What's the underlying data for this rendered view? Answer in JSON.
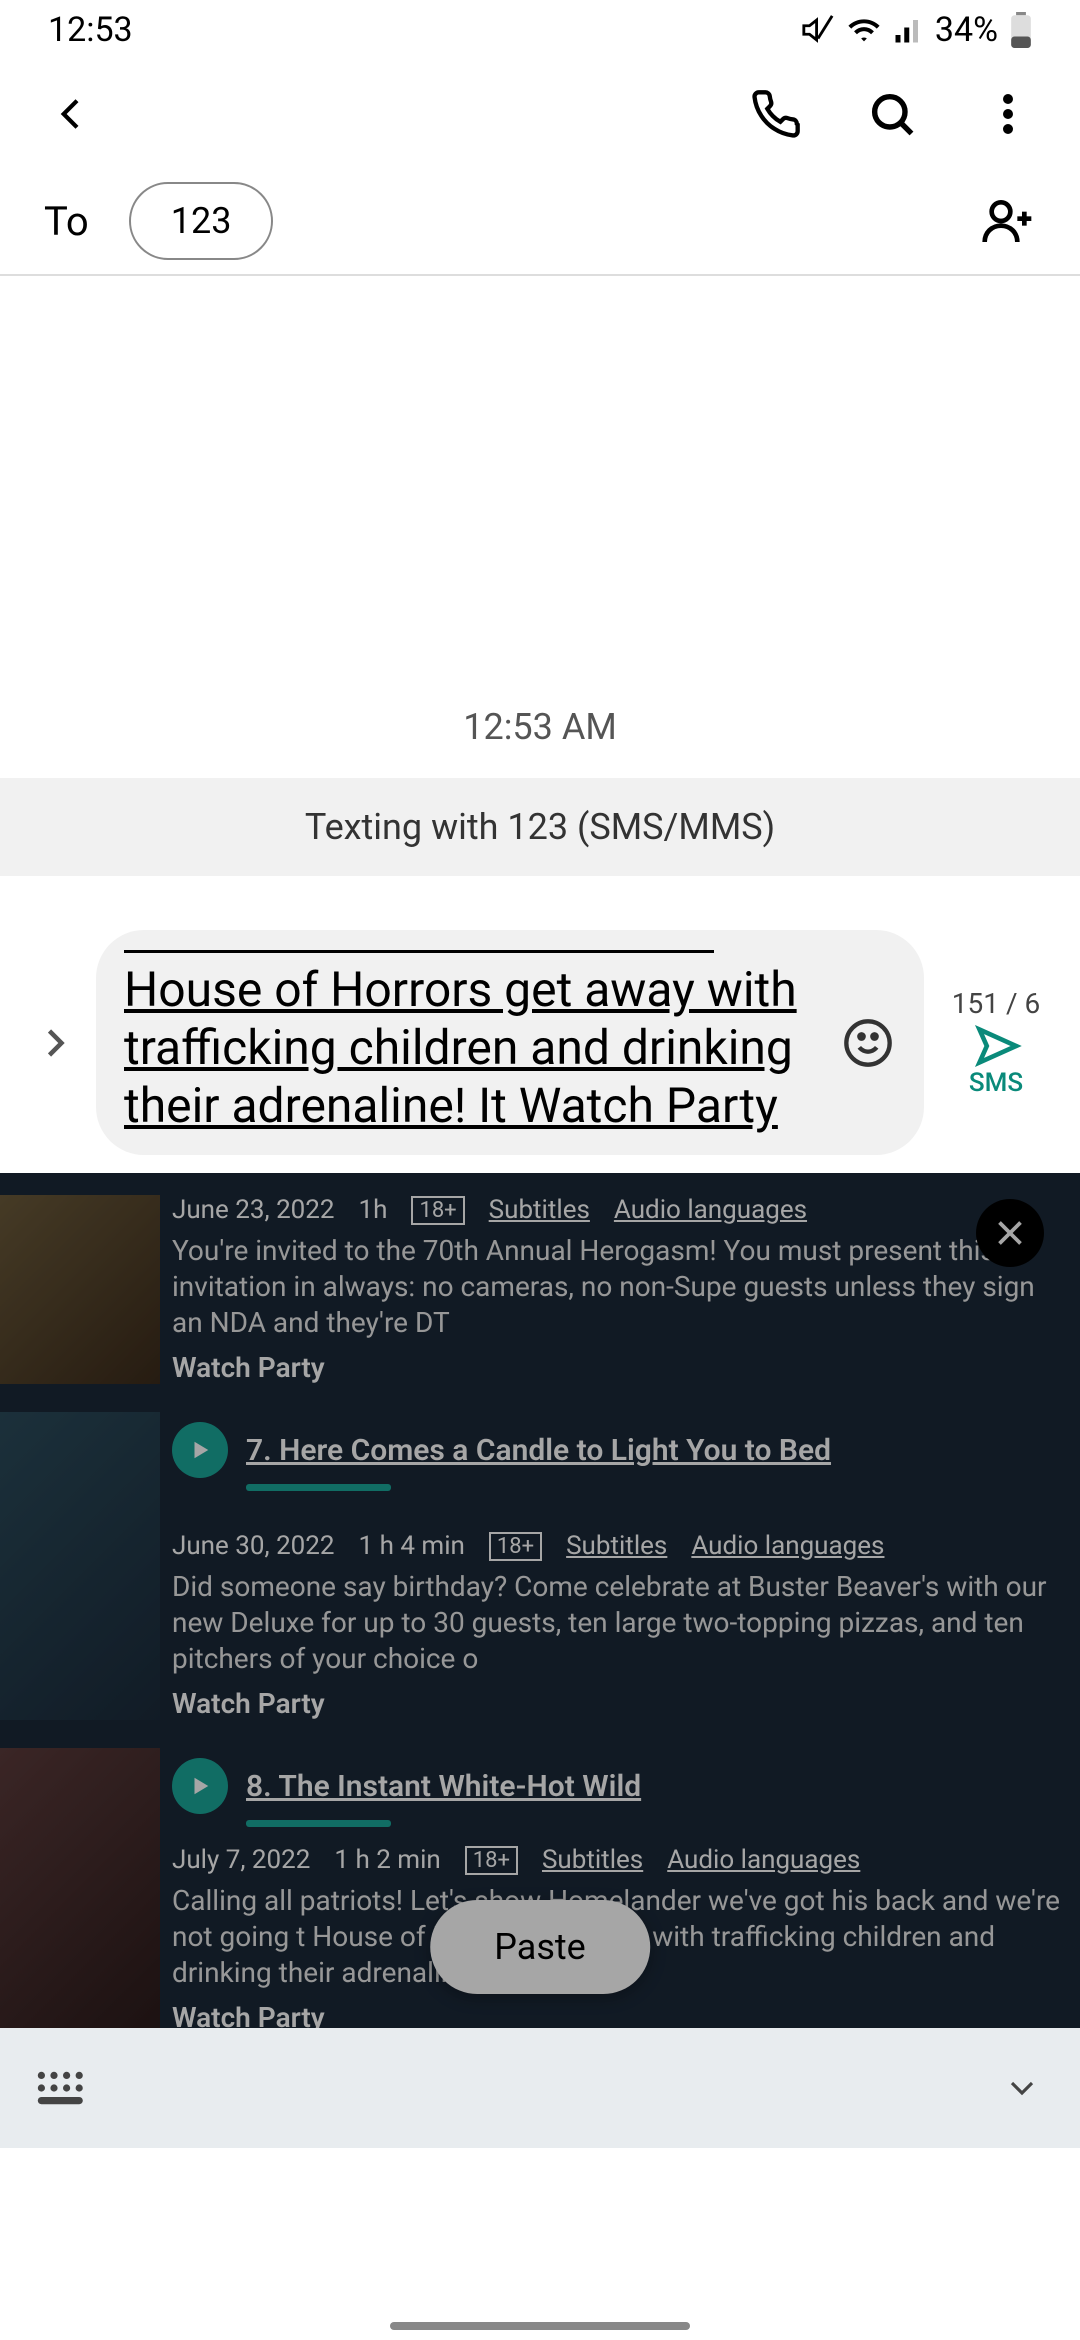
{
  "status": {
    "time": "12:53",
    "battery_pct": "34%"
  },
  "appbar": {},
  "to": {
    "label": "To",
    "recipient": "123"
  },
  "conversation": {
    "timestamp": "12:53 AM",
    "banner": "Texting with 123 (SMS/MMS)"
  },
  "compose": {
    "text": "House of Horrors get away with trafficking children and drinking their adrenaline! It Watch Party",
    "counter": "151 / 6",
    "send_label": "SMS"
  },
  "overlay": {
    "paste_label": "Paste",
    "episodes": [
      {
        "date": "June 23, 2022",
        "duration": "1h",
        "rating": "18+",
        "subtitles": "Subtitles",
        "audio": "Audio languages",
        "desc": "You're invited to the 70th Annual Herogasm! You must present this invitation in always: no cameras, no non-Supe guests unless they sign an NDA and they're DT",
        "watch_party": "Watch Party"
      },
      {
        "title": "7. Here Comes a Candle to Light You to Bed",
        "date": "June 30, 2022",
        "duration": "1 h 4 min",
        "rating": "18+",
        "subtitles": "Subtitles",
        "audio": "Audio languages",
        "desc": "Did someone say birthday? Come celebrate at Buster Beaver's with our new Deluxe for up to 30 guests, ten large two-topping pizzas, and ten pitchers of your choice o",
        "watch_party": "Watch Party"
      },
      {
        "title": "8. The Instant White-Hot Wild",
        "date": "July 7, 2022",
        "duration": "1 h 2 min",
        "rating": "18+",
        "subtitles": "Subtitles",
        "audio": "Audio languages",
        "desc": "Calling all patriots! Let's show Homelander we've got his back and we're not going t House of Horrors get away with trafficking children and drinking their adrenaline! It",
        "watch_party": "Watch Party"
      }
    ]
  }
}
